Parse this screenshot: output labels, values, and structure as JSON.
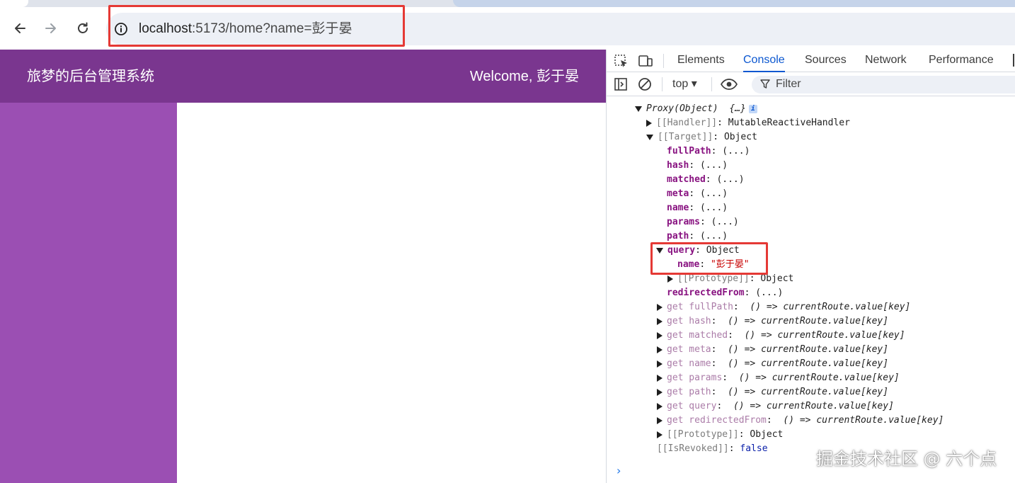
{
  "browser": {
    "url_host": "localhost",
    "url_rest": ":5173/home?name=彭于晏",
    "icons": [
      "back-arrow-icon",
      "forward-arrow-icon",
      "reload-icon",
      "site-info-icon"
    ]
  },
  "app": {
    "title": "旅梦的后台管理系统",
    "welcome": "Welcome, 彭于晏",
    "colors": {
      "header": "#7a368f",
      "sidebar": "#9b4fb3"
    }
  },
  "devtools": {
    "tabs": [
      {
        "label": "Elements",
        "active": false
      },
      {
        "label": "Console",
        "active": true
      },
      {
        "label": "Sources",
        "active": false
      },
      {
        "label": "Network",
        "active": false
      },
      {
        "label": "Performance",
        "active": false
      }
    ],
    "context": "top ▾",
    "filter_placeholder": "Filter",
    "console": {
      "root_label": "Proxy(Object)",
      "root_preview": "{…}",
      "handler_key": "[[Handler]]",
      "handler_value": "MutableReactiveHandler",
      "target_key": "[[Target]]",
      "target_value": "Object",
      "target_props": [
        {
          "key": "fullPath",
          "value": "(...)"
        },
        {
          "key": "hash",
          "value": "(...)"
        },
        {
          "key": "matched",
          "value": "(...)"
        },
        {
          "key": "meta",
          "value": "(...)"
        },
        {
          "key": "name",
          "value": "(...)"
        },
        {
          "key": "params",
          "value": "(...)"
        },
        {
          "key": "path",
          "value": "(...)"
        }
      ],
      "query_key": "query",
      "query_value": "Object",
      "query_name_key": "name",
      "query_name_value": "\"彭于晏\"",
      "query_proto_key": "[[Prototype]]",
      "query_proto_value": "Object",
      "redirected_key": "redirectedFrom",
      "redirected_value": "(...)",
      "getter_value": "() => currentRoute.value[key]",
      "getters": [
        "get fullPath",
        "get hash",
        "get matched",
        "get meta",
        "get name",
        "get params",
        "get path",
        "get query",
        "get redirectedFrom"
      ],
      "proto_key": "[[Prototype]]",
      "proto_value": "Object",
      "revoked_key": "[[IsRevoked]]",
      "revoked_value": "false"
    }
  },
  "watermark": "掘金技术社区 @ 六个点"
}
